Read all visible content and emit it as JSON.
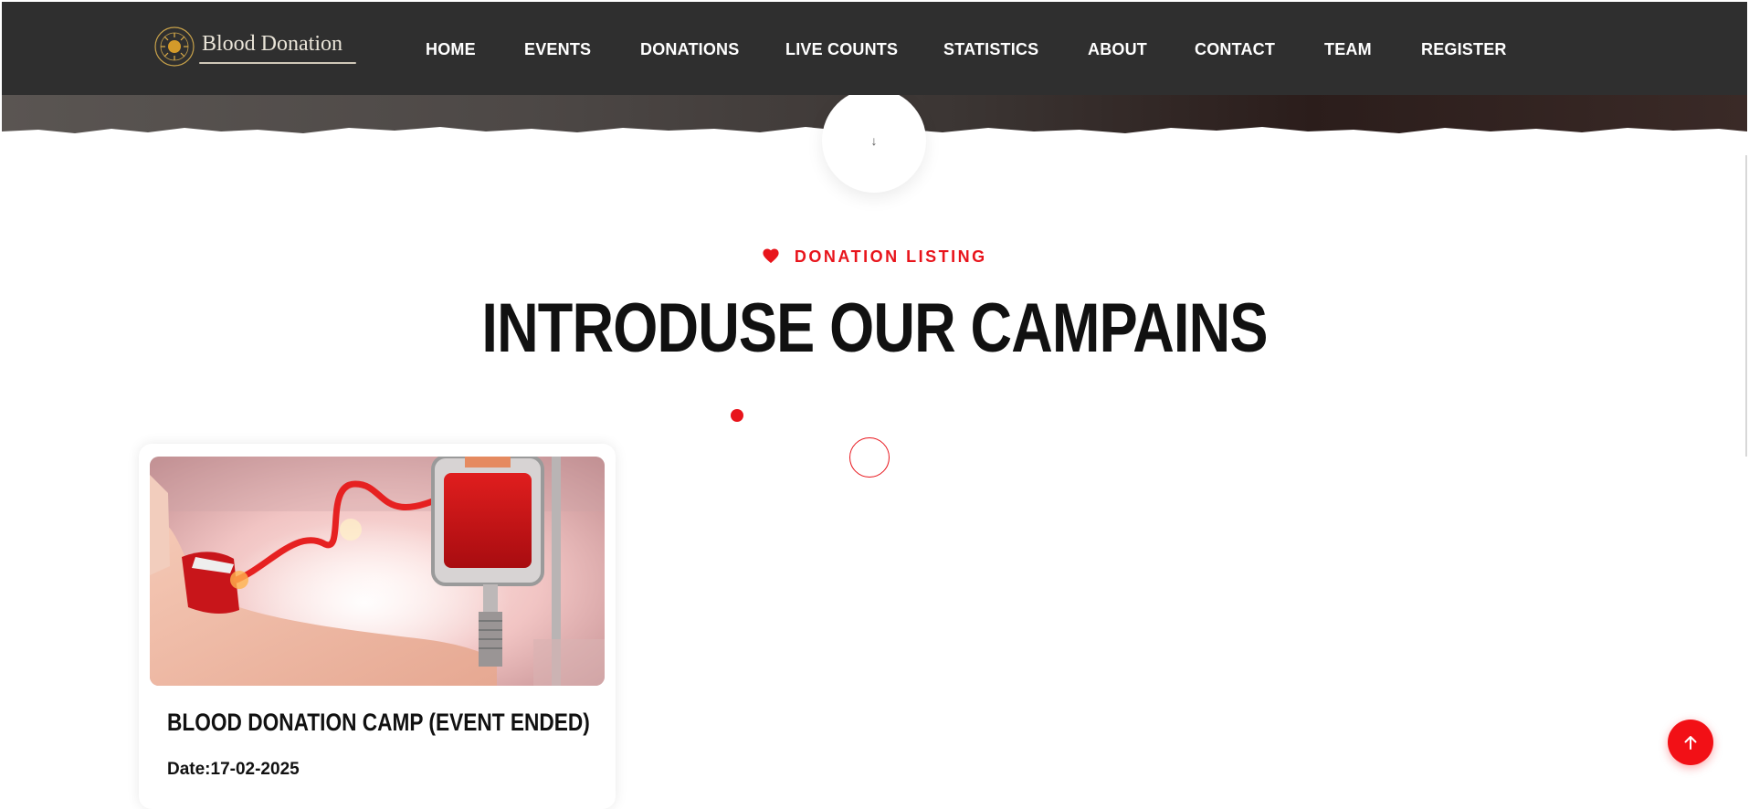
{
  "brand": {
    "name": "Blood Donation"
  },
  "nav": {
    "items": [
      {
        "label": "HOME"
      },
      {
        "label": "EVENTS"
      },
      {
        "label": "DONATIONS"
      },
      {
        "label": "LIVE COUNTS"
      },
      {
        "label": "STATISTICS"
      },
      {
        "label": "ABOUT"
      },
      {
        "label": "CONTACT"
      },
      {
        "label": "TEAM"
      },
      {
        "label": "REGISTER"
      }
    ]
  },
  "hero": {
    "scroll_down_glyph": "↓"
  },
  "section": {
    "eyebrow": "DONATION LISTING",
    "eyebrow_icon": "heart-icon",
    "title": "INTRODUSE OUR CAMPAINS"
  },
  "campaigns": [
    {
      "title": "BLOOD DONATION CAMP (EVENT ENDED)",
      "date": "Date:17-02-2025",
      "image_icon": "blood-donation-photo"
    }
  ],
  "back_to_top": {
    "icon": "arrow-up-icon"
  },
  "colors": {
    "accent": "#e8141b",
    "navbar": "#2f2f2f",
    "text": "#111111"
  }
}
